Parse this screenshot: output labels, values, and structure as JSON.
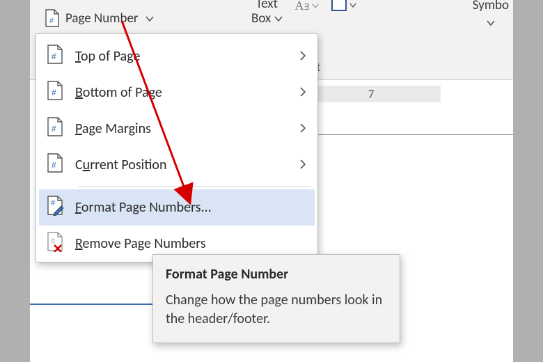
{
  "ribbon": {
    "page_number_label": "Page Number",
    "textbox_line1": "Text",
    "textbox_line2": "Box",
    "group_label": "ext",
    "symbol_label": "Symbo"
  },
  "ruler": {
    "mark": "7"
  },
  "menu": {
    "items": [
      {
        "pre": "",
        "u": "T",
        "post": "op of Page",
        "has_sub": true,
        "icon": "page"
      },
      {
        "pre": "",
        "u": "B",
        "post": "ottom of Page",
        "has_sub": true,
        "icon": "page"
      },
      {
        "pre": "",
        "u": "P",
        "post": "age Margins",
        "has_sub": true,
        "icon": "page"
      },
      {
        "pre": "C",
        "u": "u",
        "post": "rrent Position",
        "has_sub": true,
        "icon": "page"
      },
      {
        "pre": "",
        "u": "F",
        "post": "ormat Page Numbers...",
        "has_sub": false,
        "icon": "edit",
        "highlight": true
      },
      {
        "pre": "",
        "u": "R",
        "post": "emove Page Numbers",
        "has_sub": false,
        "icon": "remove"
      }
    ]
  },
  "tooltip": {
    "title": "Format Page Number",
    "body": "Change how the page numbers look in the header/footer."
  }
}
